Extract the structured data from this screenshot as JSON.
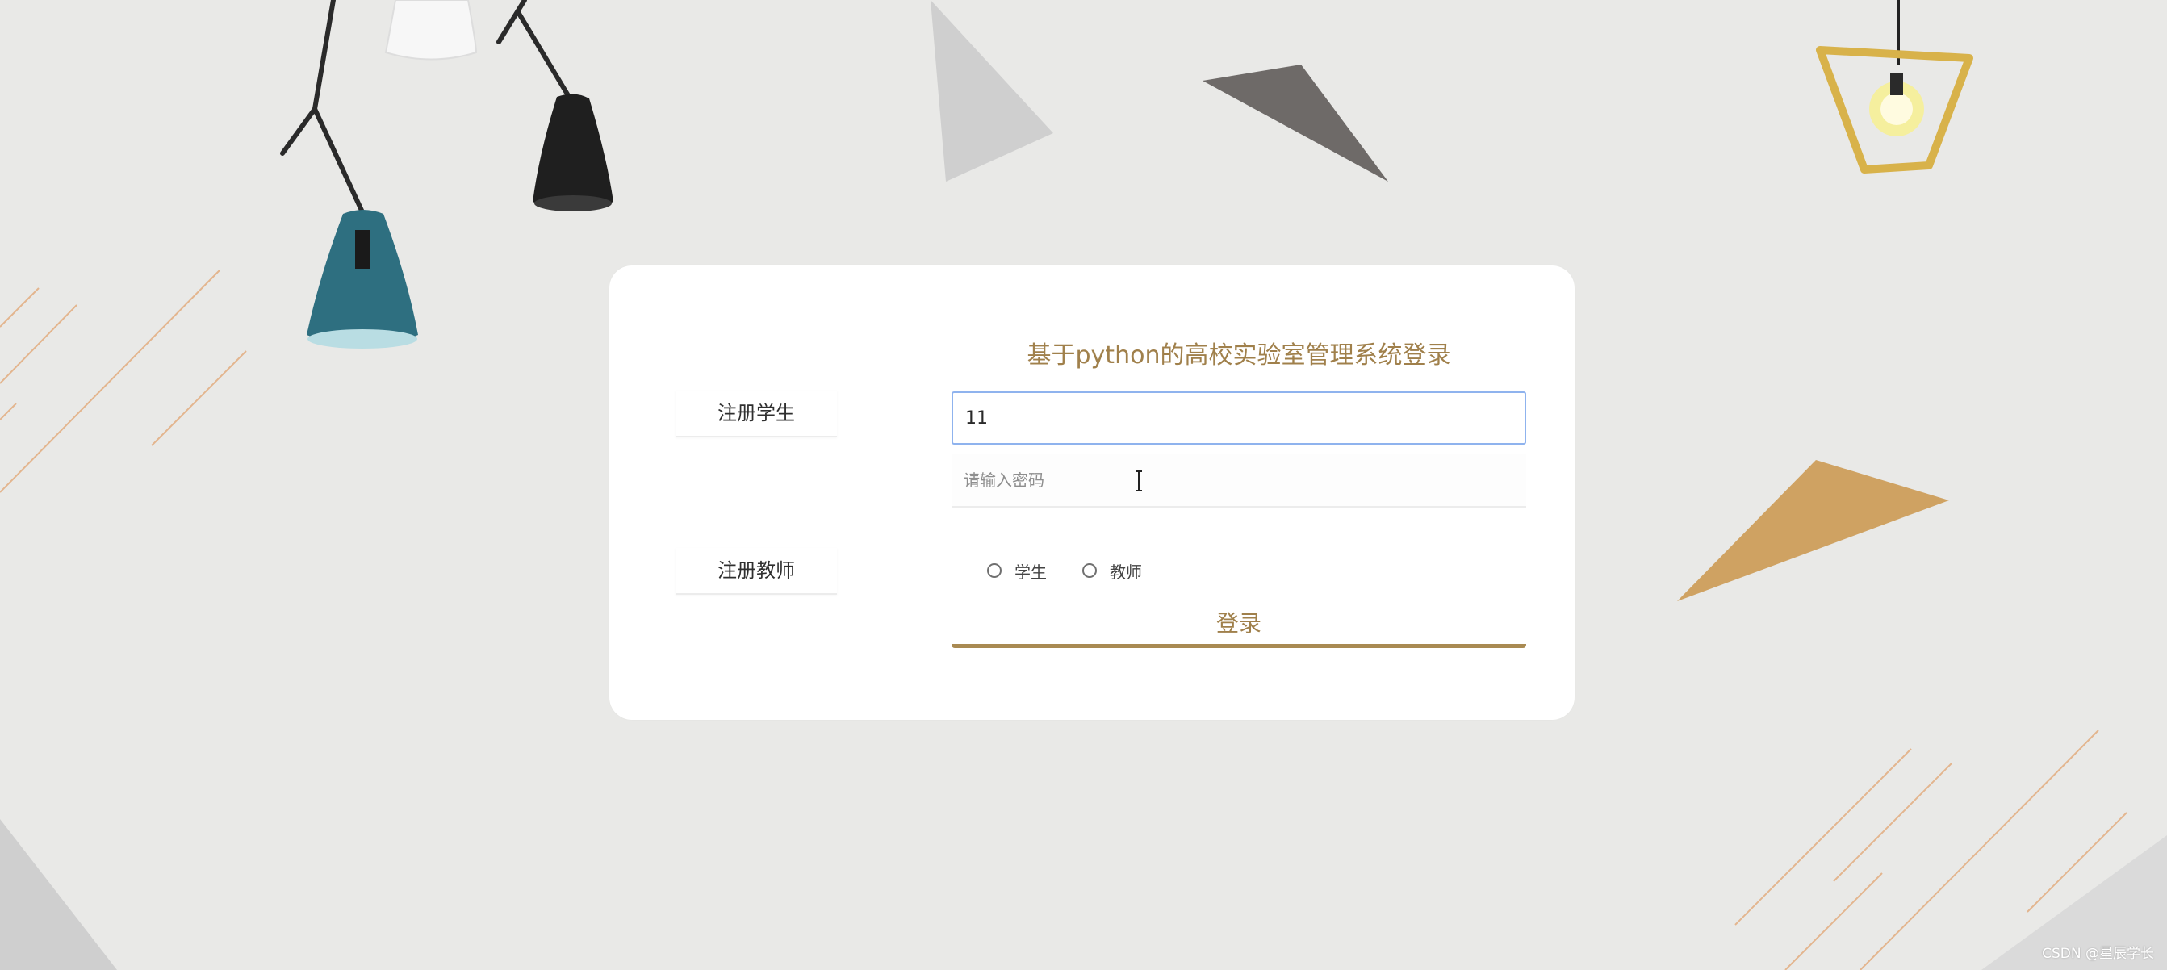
{
  "login": {
    "title": "基于python的高校实验室管理系统登录",
    "username_value": "11",
    "password_placeholder": "请输入密码",
    "roles": [
      "学生",
      "教师"
    ],
    "login_label": "登录"
  },
  "side_buttons": {
    "register_student": "注册学生",
    "register_teacher": "注册教师"
  },
  "watermark": "CSDN @星辰学长",
  "colors": {
    "background": "#e9e9e7",
    "accent": "#a0804b",
    "focus_border": "#8fb3ee"
  }
}
